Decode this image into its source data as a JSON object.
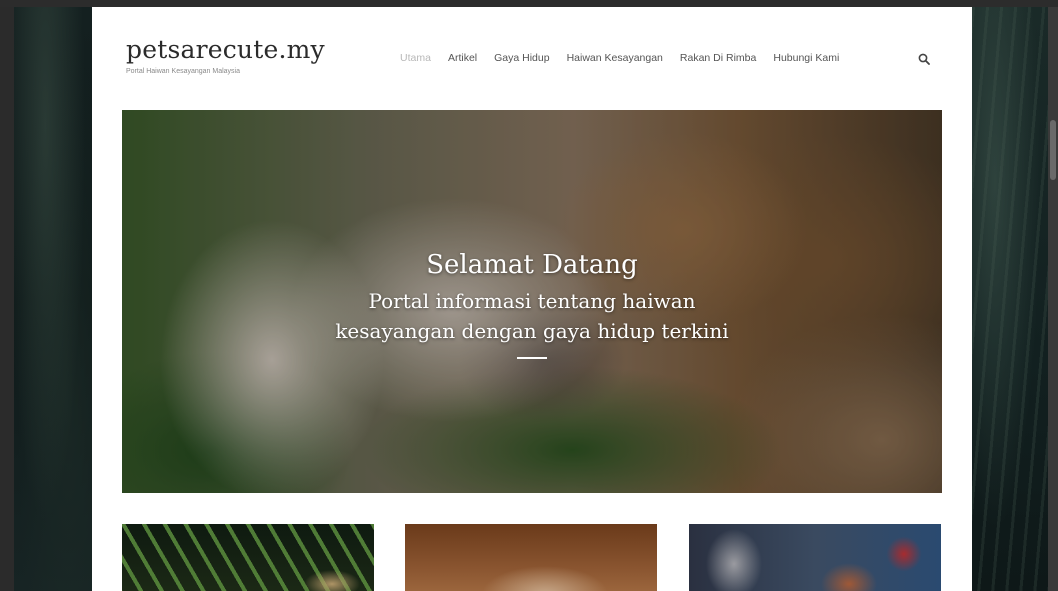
{
  "site": {
    "logo": "petsarecute.my",
    "tagline": "Portal Haiwan Kesayangan Malaysia"
  },
  "nav": {
    "items": [
      {
        "label": "Utama",
        "active": true
      },
      {
        "label": "Artikel"
      },
      {
        "label": "Gaya Hidup"
      },
      {
        "label": "Haiwan Kesayangan"
      },
      {
        "label": "Rakan Di Rimba"
      },
      {
        "label": "Hubungi Kami"
      }
    ],
    "search_icon": "search-icon"
  },
  "hero": {
    "title": "Selamat Datang",
    "subtitle": "Portal informasi tentang haiwan kesayangan dengan gaya hidup terkini"
  },
  "colors": {
    "text_dark": "#2b2b2b",
    "nav_text": "#555555",
    "nav_active": "#b8b8b8",
    "page_bg": "#ffffff"
  }
}
